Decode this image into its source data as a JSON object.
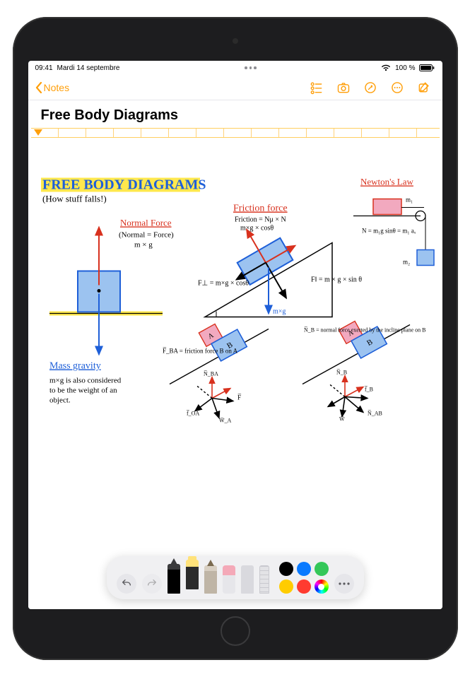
{
  "status": {
    "time": "09:41",
    "date": "Mardi 14 septembre",
    "battery_pct": "100 %"
  },
  "toolbar": {
    "back_label": "Notes"
  },
  "note": {
    "title": "Free Body Diagrams"
  },
  "drawing": {
    "heading": "FREE BODY DIAGRAMS",
    "subheading": "(How stuff falls!)",
    "normal_force_label": "Normal Force",
    "normal_force_eq1": "(Normal = Force)",
    "normal_force_eq2": "m × g",
    "mass_gravity_label": "Mass gravity",
    "mass_gravity_text1": "m×g is also considered",
    "mass_gravity_text2": "to be the weight of an",
    "mass_gravity_text3": "object.",
    "friction_label": "Friction force",
    "friction_eq1": "Friction = Nμ × N",
    "friction_eq2": "m×g × cosθ",
    "incline_left": "F⊥ =\nm×g × cosθ",
    "incline_right": "F‖ = m × g × sin θ",
    "incline_down": "m×g",
    "newton_label": "Newton's Law",
    "newton_m1": "m₁",
    "newton_m2": "m₂",
    "newton_eq": "N = m₁g sinθ =\nm₁ aₓ",
    "blockA": "A",
    "blockB": "B",
    "fba_label": "F̅_BA = friction force\nB on A",
    "nba": "N̅_BA",
    "foa": "f̅_OA",
    "wa": "W̅_A",
    "f_arrow": "F̅",
    "nb_label": "N̅_B = normal force exerted\nby the incline plane\non B",
    "nbb": "N̅_B",
    "fb": "f̅_B",
    "w": "W̅",
    "nab": "N̅_AB"
  },
  "palette": {
    "colors": [
      "#000000",
      "#0a7aff",
      "#34c759",
      "#ffcc00",
      "#ff3b30"
    ]
  }
}
